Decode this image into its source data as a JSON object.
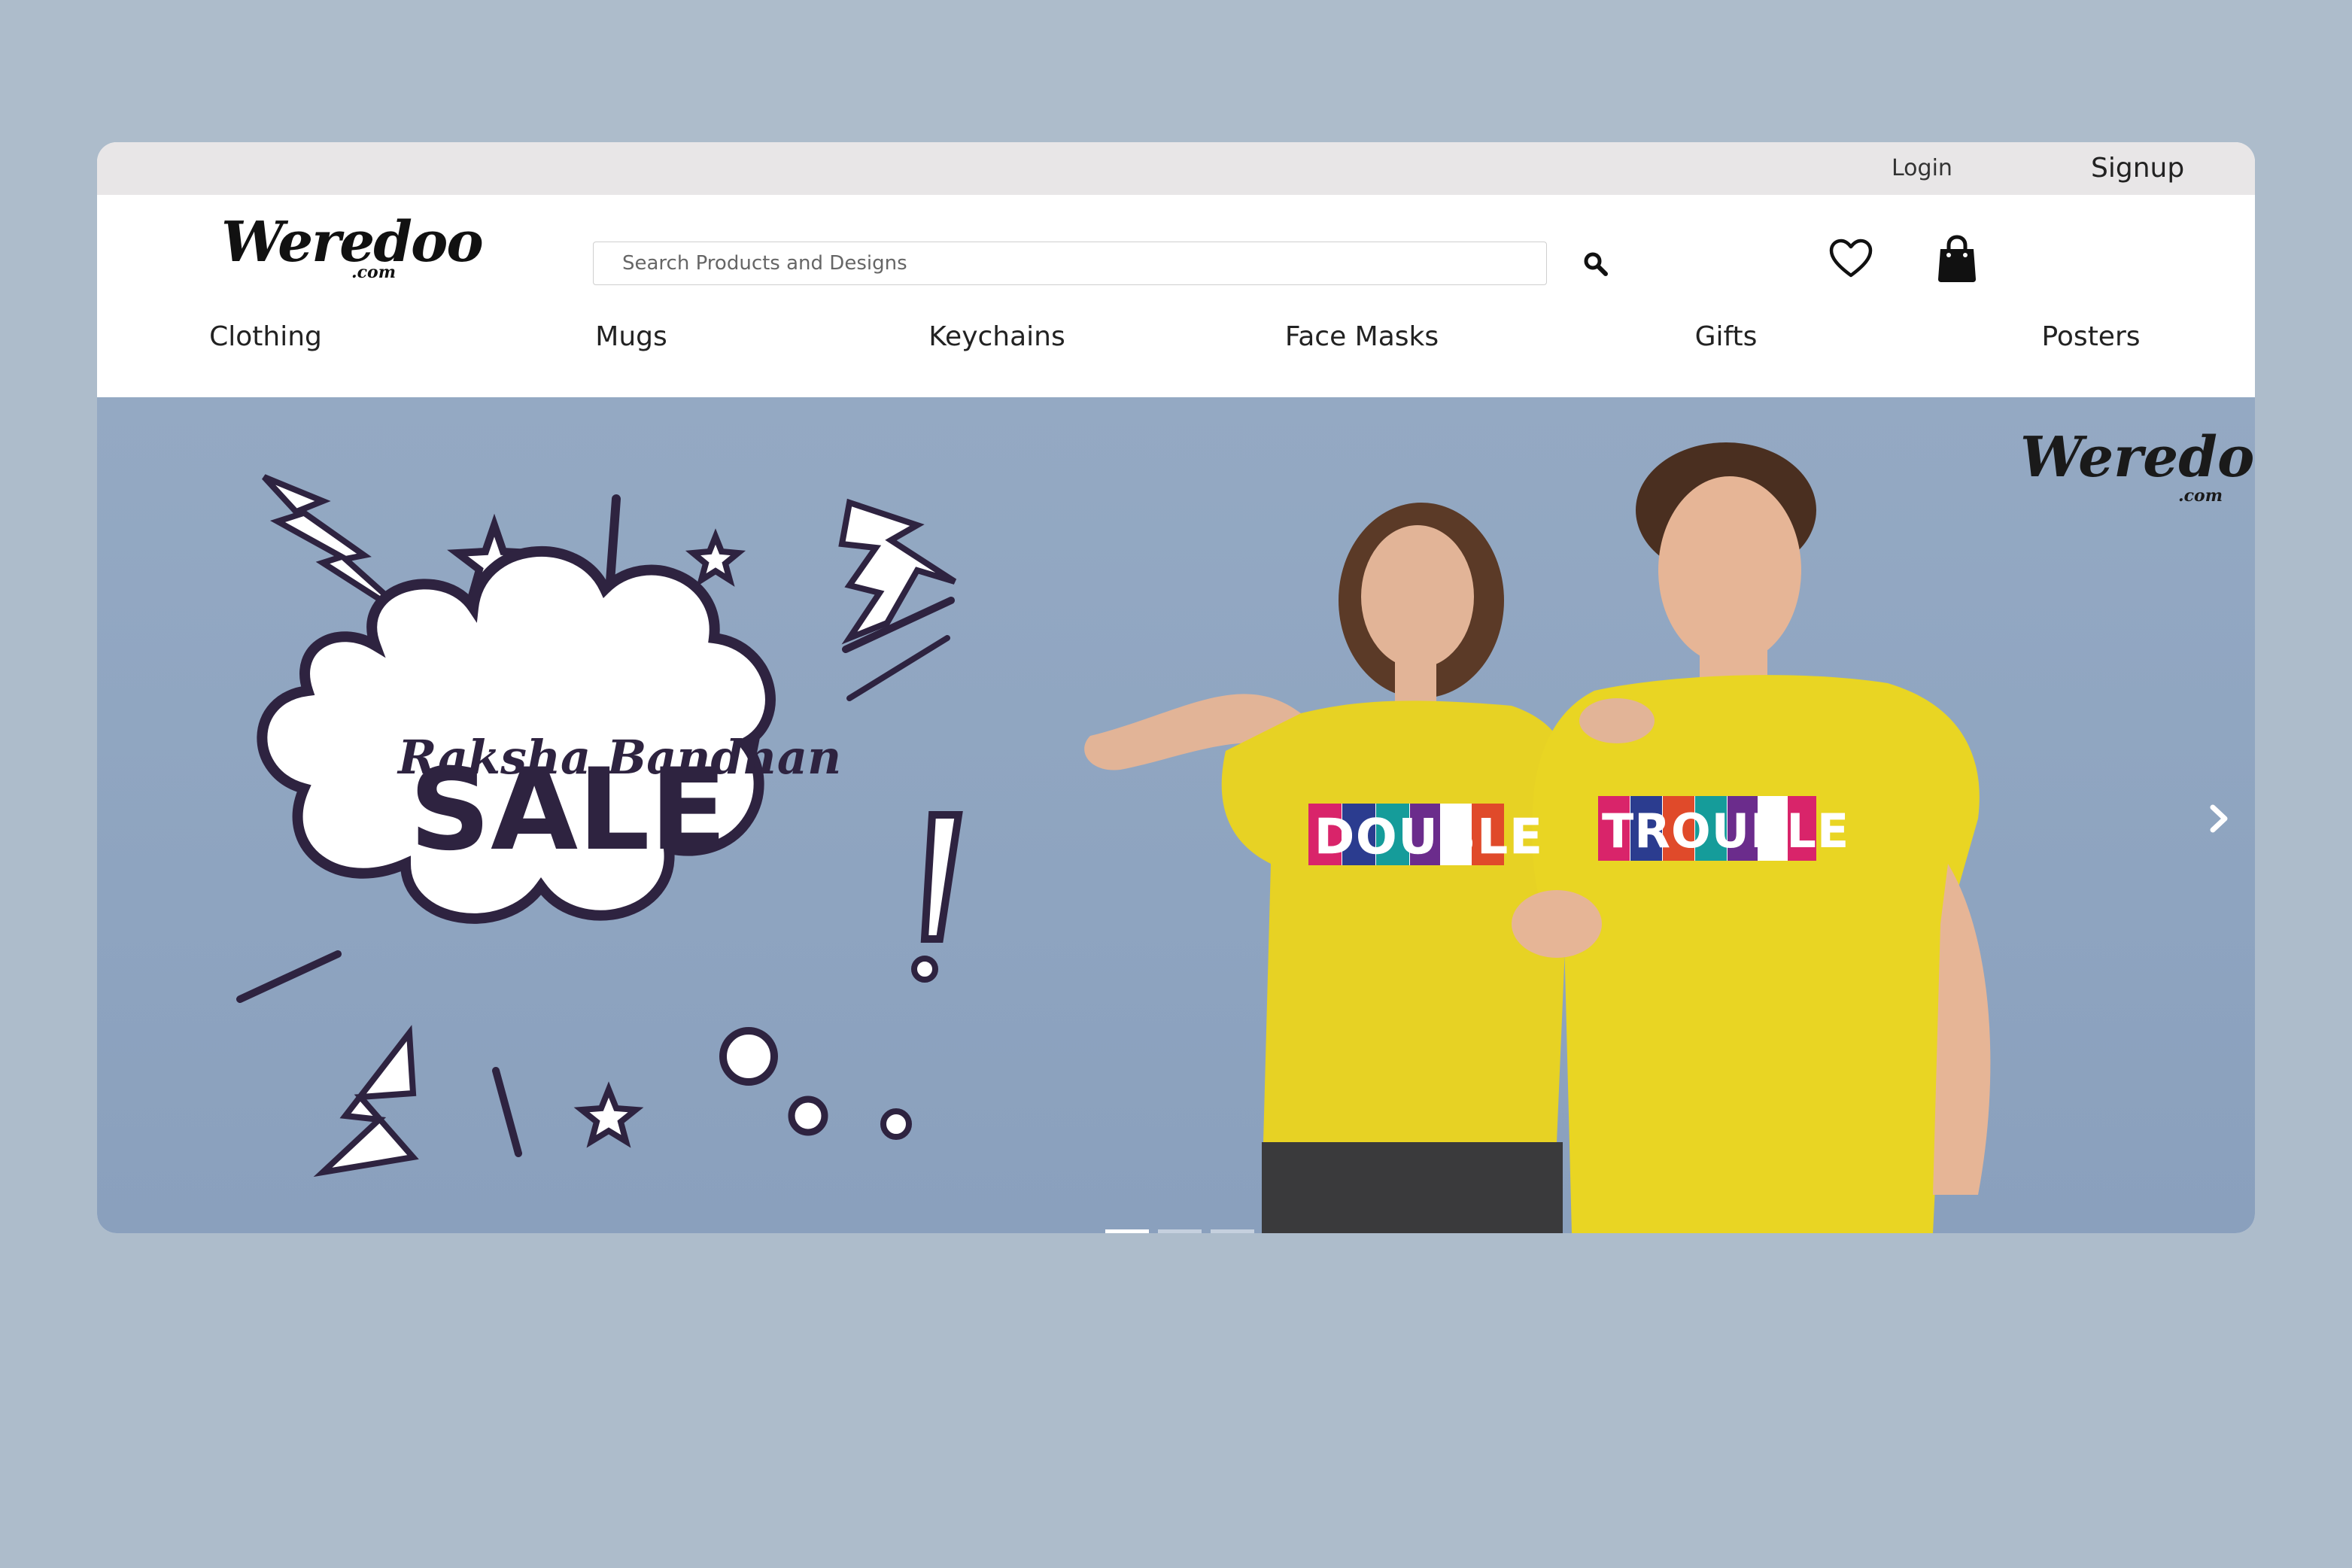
{
  "topbar": {
    "login": "Login",
    "signup": "Signup"
  },
  "brand": {
    "name": "Weredoo",
    "suffix": ".com"
  },
  "search": {
    "placeholder": "Search Products and Designs"
  },
  "icons": {
    "search": "search-icon",
    "wishlist": "heart-icon",
    "cart": "shopping-bag-icon",
    "prev": "chevron-left-icon",
    "next": "chevron-right-icon"
  },
  "nav": {
    "items": [
      {
        "label": "Clothing"
      },
      {
        "label": "Mugs"
      },
      {
        "label": "Keychains"
      },
      {
        "label": "Face Masks"
      },
      {
        "label": "Gifts"
      },
      {
        "label": "Posters"
      }
    ]
  },
  "hero": {
    "headline_script": "Raksha Bandhan",
    "headline_main": "SALE",
    "shirt_left": "DOUBLE",
    "shirt_right": "TROUBLE",
    "watermark_name": "Weredoo",
    "watermark_suffix": ".com",
    "slides_total": 3,
    "active_slide": 1
  },
  "colors": {
    "page_bg": "#adbccb",
    "topbar_bg": "#e8e6e7",
    "hero_bg": "#94a9c3",
    "shirt_yellow": "#e7d224",
    "accent_dark": "#2e2340"
  }
}
